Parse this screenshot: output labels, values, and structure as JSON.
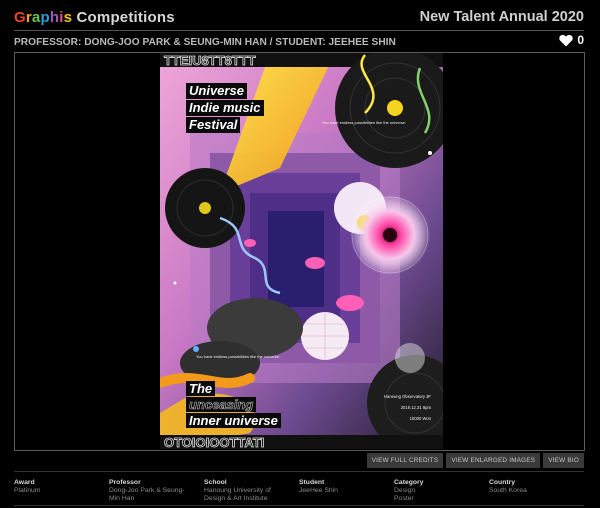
{
  "header": {
    "logo_brand": "Graphis",
    "logo_suffix": "Competitions",
    "annual_title": "New Talent Annual 2020"
  },
  "entry": {
    "credits_line": "PROFESSOR: DONG-JOO PARK & SEUNG-MIN HAN / STUDENT: JEEHEE SHIN",
    "like_count": "0",
    "like_icon": "heart-icon"
  },
  "poster": {
    "title_lines": [
      "Universe",
      "Indie music",
      "Festival"
    ],
    "tagline": "You have endless possibilities like the universe.",
    "bottom_lines": [
      "The",
      "unceasing",
      "Inner universe"
    ],
    "venue": "Haneung Observatory 3F",
    "date": "2019.12.31 8pm",
    "price": "15000 Won"
  },
  "actions": {
    "view_full_credits": "VIEW FULL CREDITS",
    "view_enlarged_images": "VIEW ENLARGED IMAGES",
    "view_bio": "VIEW BIO"
  },
  "info": [
    {
      "label": "Award",
      "values": [
        "Platinum"
      ]
    },
    {
      "label": "Professor",
      "values": [
        "Dong-Joo Park & Seung-",
        "Min Han"
      ]
    },
    {
      "label": "School",
      "values": [
        "Hanoung University of",
        "Design & Art Institute"
      ]
    },
    {
      "label": "Student",
      "values": [
        "JeeHee Shin"
      ]
    },
    {
      "label": "Category",
      "values": [
        "Design",
        "Poster"
      ]
    },
    {
      "label": "Country",
      "values": [
        "South Korea"
      ]
    }
  ],
  "colors": {
    "background": "#000000",
    "button_bg": "#3a3a3a",
    "poster_pink": "#e880c0",
    "poster_purple": "#6a3f9a",
    "poster_yellow": "#f5d31e"
  }
}
